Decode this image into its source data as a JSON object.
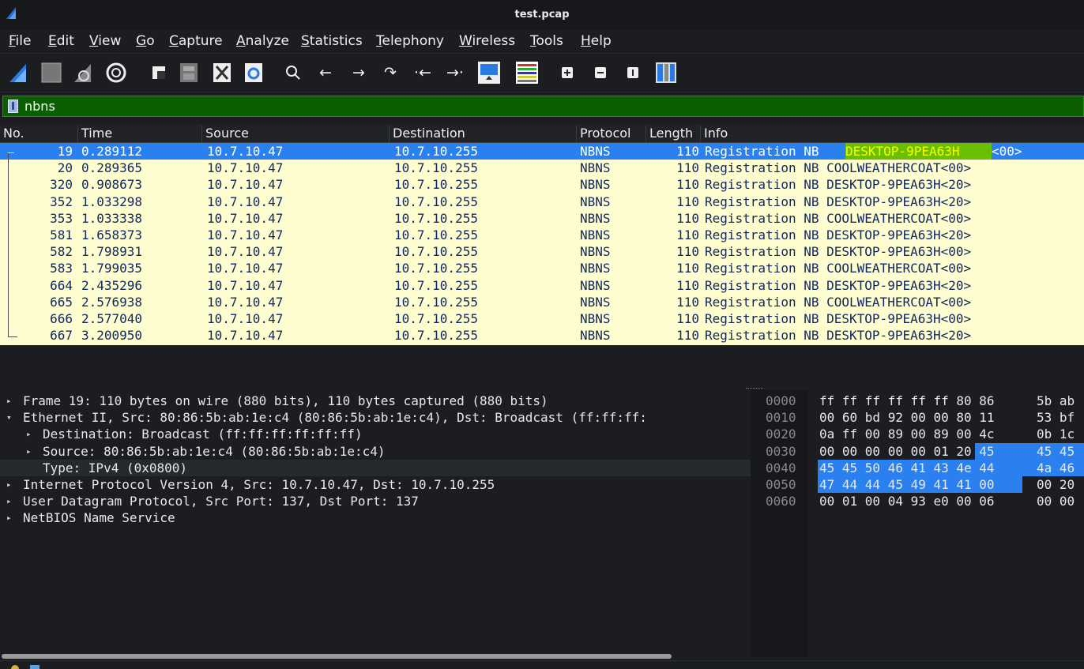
{
  "window": {
    "title": "test.pcap"
  },
  "menu": [
    "File",
    "Edit",
    "View",
    "Go",
    "Capture",
    "Analyze",
    "Statistics",
    "Telephony",
    "Wireless",
    "Tools",
    "Help"
  ],
  "toolbar": {
    "buttons": [
      "start-capture",
      "stop-capture",
      "restart-capture",
      "capture-options",
      "open-file",
      "save-file",
      "close-file",
      "reload-file",
      "find-packet",
      "go-back",
      "go-forward",
      "go-to-packet",
      "first-packet",
      "last-packet",
      "auto-scroll",
      "colorize",
      "zoom-in",
      "zoom-out",
      "normal-size",
      "resize-columns"
    ]
  },
  "filter": {
    "value": "nbns"
  },
  "packet_list": {
    "columns": [
      "No.",
      "Time",
      "Source",
      "Destination",
      "Protocol",
      "Length",
      "Info"
    ],
    "rows": [
      {
        "no": "19",
        "time": "0.289112",
        "source": "10.7.10.47",
        "destination": "10.7.10.255",
        "protocol": "NBNS",
        "length": "110",
        "info_prefix": "Registration NB ",
        "info_name": "DESKTOP-9PEA63H",
        "info_suffix": "<00>",
        "selected": true
      },
      {
        "no": "20",
        "time": "0.289365",
        "source": "10.7.10.47",
        "destination": "10.7.10.255",
        "protocol": "NBNS",
        "length": "110",
        "info": "Registration NB COOLWEATHERCOAT<00>"
      },
      {
        "no": "320",
        "time": "0.908673",
        "source": "10.7.10.47",
        "destination": "10.7.10.255",
        "protocol": "NBNS",
        "length": "110",
        "info": "Registration NB DESKTOP-9PEA63H<20>"
      },
      {
        "no": "352",
        "time": "1.033298",
        "source": "10.7.10.47",
        "destination": "10.7.10.255",
        "protocol": "NBNS",
        "length": "110",
        "info": "Registration NB DESKTOP-9PEA63H<20>"
      },
      {
        "no": "353",
        "time": "1.033338",
        "source": "10.7.10.47",
        "destination": "10.7.10.255",
        "protocol": "NBNS",
        "length": "110",
        "info": "Registration NB COOLWEATHERCOAT<00>"
      },
      {
        "no": "581",
        "time": "1.658373",
        "source": "10.7.10.47",
        "destination": "10.7.10.255",
        "protocol": "NBNS",
        "length": "110",
        "info": "Registration NB DESKTOP-9PEA63H<20>"
      },
      {
        "no": "582",
        "time": "1.798931",
        "source": "10.7.10.47",
        "destination": "10.7.10.255",
        "protocol": "NBNS",
        "length": "110",
        "info": "Registration NB DESKTOP-9PEA63H<00>"
      },
      {
        "no": "583",
        "time": "1.799035",
        "source": "10.7.10.47",
        "destination": "10.7.10.255",
        "protocol": "NBNS",
        "length": "110",
        "info": "Registration NB COOLWEATHERCOAT<00>"
      },
      {
        "no": "664",
        "time": "2.435296",
        "source": "10.7.10.47",
        "destination": "10.7.10.255",
        "protocol": "NBNS",
        "length": "110",
        "info": "Registration NB DESKTOP-9PEA63H<20>"
      },
      {
        "no": "665",
        "time": "2.576938",
        "source": "10.7.10.47",
        "destination": "10.7.10.255",
        "protocol": "NBNS",
        "length": "110",
        "info": "Registration NB COOLWEATHERCOAT<00>"
      },
      {
        "no": "666",
        "time": "2.577040",
        "source": "10.7.10.47",
        "destination": "10.7.10.255",
        "protocol": "NBNS",
        "length": "110",
        "info": "Registration NB DESKTOP-9PEA63H<00>"
      },
      {
        "no": "667",
        "time": "3.200950",
        "source": "10.7.10.47",
        "destination": "10.7.10.255",
        "protocol": "NBNS",
        "length": "110",
        "info": "Registration NB DESKTOP-9PEA63H<20>"
      }
    ]
  },
  "details": [
    {
      "indent": 0,
      "expander": "collapsed",
      "text": "Frame 19: 110 bytes on wire (880 bits), 110 bytes captured (880 bits)"
    },
    {
      "indent": 0,
      "expander": "expanded",
      "text": "Ethernet II, Src: 80:86:5b:ab:1e:c4 (80:86:5b:ab:1e:c4), Dst: Broadcast (ff:ff:ff:"
    },
    {
      "indent": 1,
      "expander": "collapsed",
      "text": "Destination: Broadcast (ff:ff:ff:ff:ff:ff)"
    },
    {
      "indent": 1,
      "expander": "collapsed",
      "text": "Source: 80:86:5b:ab:1e:c4 (80:86:5b:ab:1e:c4)"
    },
    {
      "indent": 1,
      "expander": "none",
      "text": "Type: IPv4 (0x0800)"
    },
    {
      "indent": 0,
      "expander": "collapsed",
      "text": "Internet Protocol Version 4, Src: 10.7.10.47, Dst: 10.7.10.255"
    },
    {
      "indent": 0,
      "expander": "collapsed",
      "text": "User Datagram Protocol, Src Port: 137, Dst Port: 137"
    },
    {
      "indent": 0,
      "expander": "collapsed",
      "text": "NetBIOS Name Service"
    }
  ],
  "bytes": [
    {
      "offset": "0000",
      "hexA": "ff ff ff ff ff ff 80 86",
      "hexB": "5b ab"
    },
    {
      "offset": "0010",
      "hexA": "00 60 bd 92 00 00 80 11",
      "hexB": "53 bf"
    },
    {
      "offset": "0020",
      "hexA": "0a ff 00 89 00 89 00 4c",
      "hexB": "0b 1c"
    },
    {
      "offset": "0030",
      "hexA": "00 00 00 00 00 01 20 45",
      "hexB": "45 45"
    },
    {
      "offset": "0040",
      "hexA": "45 45 50 46 41 43 4e 44",
      "hexB": "4a 46"
    },
    {
      "offset": "0050",
      "hexA": "47 44 44 45 49 41 41 00",
      "hexB": "00 20"
    },
    {
      "offset": "0060",
      "hexA": "00 01 00 04 93 e0 00 06",
      "hexB": "00 00"
    }
  ],
  "colors": {
    "selected_row": "#2b80f0",
    "packet_row_bg": "#fdfdd0",
    "packet_row_text": "#12275e",
    "filter_bg": "#0b5e00",
    "name_highlight_bg": "#6cbf00",
    "name_highlight_text": "#f5ff00"
  }
}
